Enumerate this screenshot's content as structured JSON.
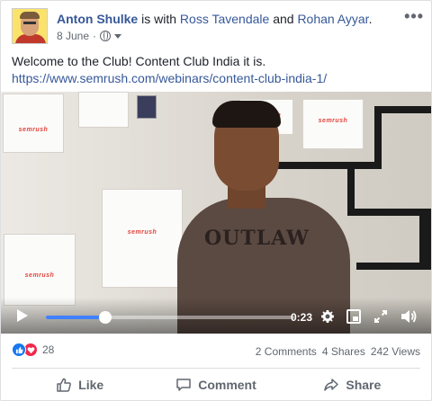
{
  "post": {
    "author": "Anton Shulke",
    "with_text": "is with",
    "tagged_1": "Ross Tavendale",
    "and_text": "and",
    "tagged_2": "Rohan Ayyar",
    "period": ".",
    "date": "8 June",
    "dot": "·",
    "more_label": "•••",
    "message_line1": "Welcome to the Club! Content Club India it is.",
    "message_url": "https://www.semrush.com/webinars/content-club-india-1/"
  },
  "video": {
    "bag_logo": "semrush",
    "shirt_text": "OUTLAW",
    "time": "0:23",
    "progress_fraction": 0.24
  },
  "stats": {
    "reaction_count": "28",
    "comments": "2 Comments",
    "shares": "4 Shares",
    "views": "242 Views"
  },
  "actions": {
    "like": "Like",
    "comment": "Comment",
    "share": "Share"
  },
  "colors": {
    "link": "#365899",
    "like_blue": "#1877f2",
    "love_red": "#f0284a",
    "progress": "#4080ff"
  }
}
